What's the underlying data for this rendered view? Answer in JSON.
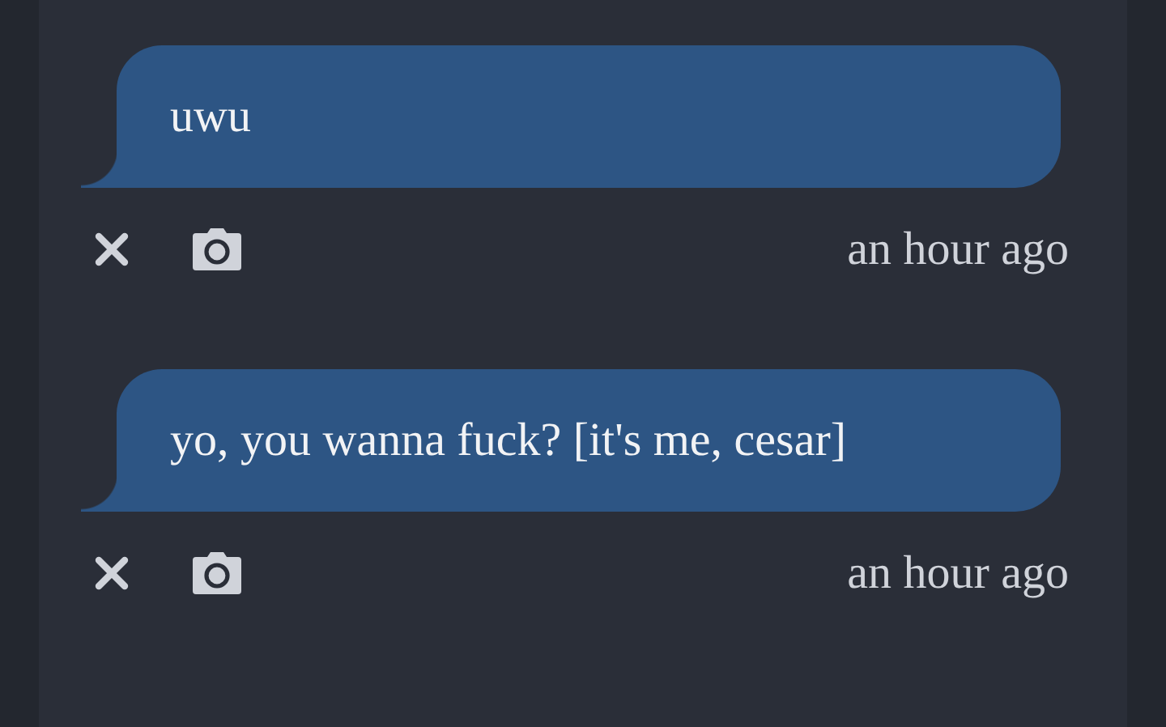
{
  "messages": [
    {
      "text": "uwu",
      "time": "an hour ago"
    },
    {
      "text": "yo, you wanna fuck? [it's me, cesar]",
      "time": "an hour ago"
    }
  ]
}
